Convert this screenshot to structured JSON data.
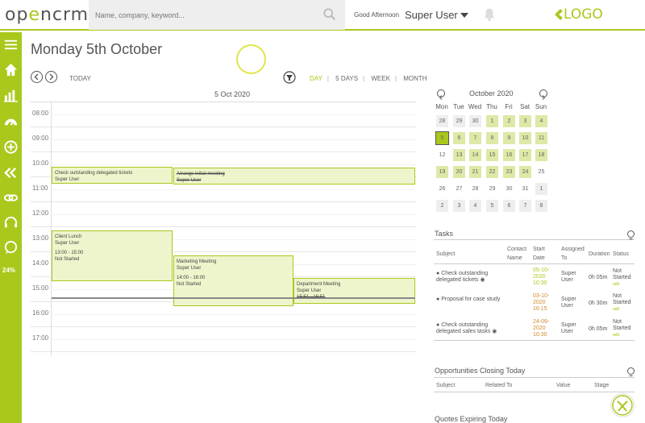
{
  "brand": {
    "part1": "op",
    "part2": "e",
    "part3": "ncrm"
  },
  "search": {
    "placeholder": "Name, company, keyword..."
  },
  "header": {
    "greeting": "Good Afternoon",
    "user": "Super User",
    "logo": "LOGO"
  },
  "sidebar": {
    "percent": "24%"
  },
  "calendar": {
    "title": "Monday 5th October",
    "today_label": "TODAY",
    "views": [
      "DAY",
      "5 DAYS",
      "WEEK",
      "MONTH"
    ],
    "date_heading": "5 Oct 2020",
    "hours": [
      "08:00",
      "09:00",
      "10:00",
      "11:00",
      "12:00",
      "13:00",
      "14:00",
      "15:00",
      "16:00",
      "17:00"
    ],
    "events": [
      {
        "title": "Check outstanding delegated tickets",
        "owner": "Super User",
        "time": "",
        "status": ""
      },
      {
        "title": "Arrange initial meeting",
        "owner": "Super User",
        "time": "",
        "status": ""
      },
      {
        "title": "Client Lunch",
        "owner": "Super User",
        "time": "13:00 - 15:00",
        "status": "Not Started"
      },
      {
        "title": "Marketing Meeting",
        "owner": "Super User",
        "time": "14:00 - 16:00",
        "status": "Not Started"
      },
      {
        "title": "Department Meeting",
        "owner": "Super User",
        "time": "15:51 - 16:51",
        "status": ""
      }
    ]
  },
  "mini_calendar": {
    "title": "October 2020",
    "dow": [
      "Mon",
      "Tue",
      "Wed",
      "Thu",
      "Fri",
      "Sat",
      "Sun"
    ],
    "weeks": [
      [
        "28",
        "29",
        "30",
        "1",
        "2",
        "3",
        "4"
      ],
      [
        "5",
        "6",
        "7",
        "8",
        "9",
        "10",
        "11"
      ],
      [
        "12",
        "13",
        "14",
        "15",
        "16",
        "17",
        "18"
      ],
      [
        "19",
        "20",
        "21",
        "22",
        "23",
        "24",
        "25"
      ],
      [
        "26",
        "27",
        "28",
        "29",
        "30",
        "31",
        "1"
      ],
      [
        "2",
        "3",
        "4",
        "5",
        "6",
        "7",
        "8"
      ]
    ]
  },
  "tasks": {
    "title": "Tasks",
    "headers": {
      "subject": "Subject",
      "contact": "Contact Name",
      "start": "Start Date",
      "assigned": "Assigned To",
      "duration": "Duration",
      "status": "Status"
    },
    "rows": [
      {
        "subject": "Check outstanding delegated tickets",
        "start": "05-10-2020 10:30",
        "assigned": "Super User",
        "duration": "0h 05m",
        "status": "Not Started",
        "tag": "add"
      },
      {
        "subject": "Proposal for case study",
        "start": "03-10-2020 16:15",
        "assigned": "Super User",
        "duration": "0h 30m",
        "status": "Not Started",
        "tag": "add"
      },
      {
        "subject": "Check outstanding delegated sales tasks",
        "start": "24-09-2020 10:30",
        "assigned": "Super User",
        "duration": "0h 05m",
        "status": "Not Started",
        "tag": "add"
      }
    ]
  },
  "opportunities": {
    "title": "Opportunities Closing Today",
    "headers": {
      "subject": "Subject",
      "related": "Related To",
      "value": "Value",
      "stage": "Stage"
    }
  },
  "quotes": {
    "title": "Quotes Expiring Today"
  },
  "colors": {
    "accent": "#a8c81c",
    "overdue": "#d28a2a"
  }
}
